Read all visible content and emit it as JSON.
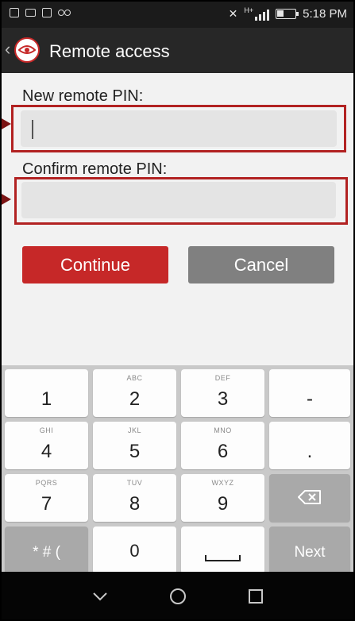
{
  "status_bar": {
    "time": "5:18 PM",
    "network": "H+",
    "left_icons": [
      "gallery-icon",
      "mail-icon",
      "sd-card-icon",
      "voicemail-icon"
    ]
  },
  "action_bar": {
    "title": "Remote access"
  },
  "form": {
    "new_pin": {
      "label": "New remote PIN:",
      "value": "",
      "placeholder": ""
    },
    "confirm_pin": {
      "label": "Confirm remote PIN:",
      "value": "",
      "placeholder": ""
    }
  },
  "buttons": {
    "continue": "Continue",
    "cancel": "Cancel"
  },
  "keyboard": {
    "rows": [
      [
        {
          "main": "1",
          "sub": ""
        },
        {
          "main": "2",
          "sub": "ABC"
        },
        {
          "main": "3",
          "sub": "DEF"
        },
        {
          "main": "-",
          "sub": ""
        }
      ],
      [
        {
          "main": "4",
          "sub": "GHI"
        },
        {
          "main": "5",
          "sub": "JKL"
        },
        {
          "main": "6",
          "sub": "MNO"
        },
        {
          "main": ".",
          "sub": ""
        }
      ],
      [
        {
          "main": "7",
          "sub": "PQRS"
        },
        {
          "main": "8",
          "sub": "TUV"
        },
        {
          "main": "9",
          "sub": "WXYZ"
        },
        {
          "main": "",
          "sub": ""
        }
      ],
      [
        {
          "main": "* # (",
          "sub": ""
        },
        {
          "main": "0",
          "sub": ""
        },
        {
          "main": "",
          "sub": ""
        },
        {
          "main": "Next",
          "sub": ""
        }
      ]
    ]
  },
  "colors": {
    "accent": "#c62828",
    "highlight_outline": "#b22222",
    "cancel": "#808080",
    "action_bar": "#272727"
  }
}
